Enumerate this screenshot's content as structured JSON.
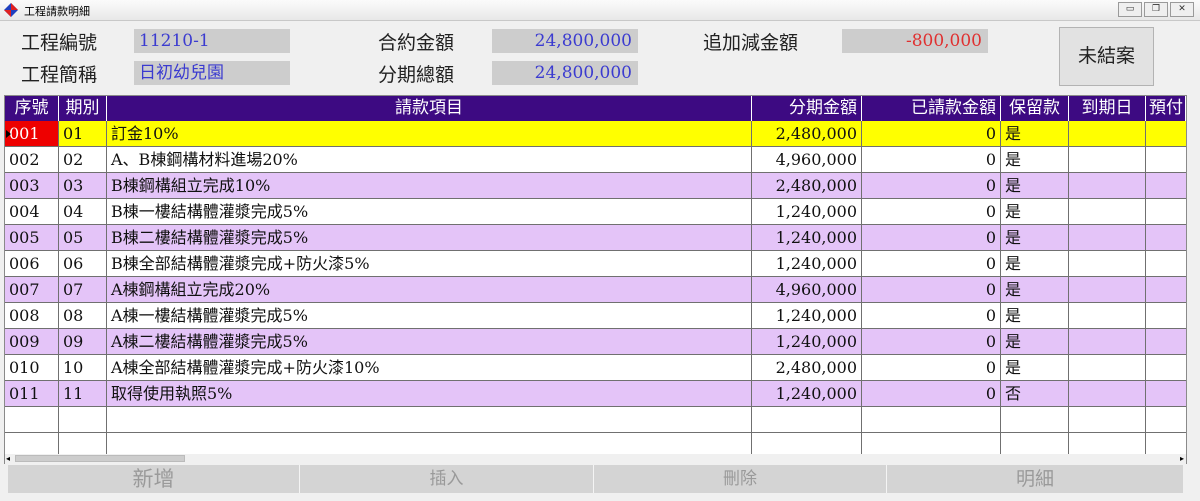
{
  "window": {
    "title": "工程請款明細",
    "min_glyph": "▭",
    "restore_glyph": "❐",
    "close_glyph": "✕"
  },
  "header": {
    "project_no_label": "工程編號",
    "project_no": "11210-1",
    "project_name_label": "工程簡稱",
    "project_name": "日初幼兒園",
    "contract_amount_label": "合約金額",
    "contract_amount": "24,800,000",
    "installment_total_label": "分期總額",
    "installment_total": "24,800,000",
    "adjust_amount_label": "追加減金額",
    "adjust_amount": "-800,000",
    "status_button": "未結案"
  },
  "table": {
    "columns": [
      "序號",
      "期別",
      "請款項目",
      "分期金額",
      "已請款金額",
      "保留款",
      "到期日",
      "預付"
    ],
    "rows": [
      {
        "seq": "001",
        "period": "01",
        "item": "訂金10%",
        "amount": "2,480,000",
        "requested": "0",
        "retention": "是",
        "due": ""
      },
      {
        "seq": "002",
        "period": "02",
        "item": "A、B棟鋼構材料進場20%",
        "amount": "4,960,000",
        "requested": "0",
        "retention": "是",
        "due": ""
      },
      {
        "seq": "003",
        "period": "03",
        "item": "B棟鋼構組立完成10%",
        "amount": "2,480,000",
        "requested": "0",
        "retention": "是",
        "due": ""
      },
      {
        "seq": "004",
        "period": "04",
        "item": "B棟一樓結構體灌漿完成5%",
        "amount": "1,240,000",
        "requested": "0",
        "retention": "是",
        "due": ""
      },
      {
        "seq": "005",
        "period": "05",
        "item": "B棟二樓結構體灌漿完成5%",
        "amount": "1,240,000",
        "requested": "0",
        "retention": "是",
        "due": ""
      },
      {
        "seq": "006",
        "period": "06",
        "item": "B棟全部結構體灌漿完成+防火漆5%",
        "amount": "1,240,000",
        "requested": "0",
        "retention": "是",
        "due": ""
      },
      {
        "seq": "007",
        "period": "07",
        "item": "A棟鋼構組立完成20%",
        "amount": "4,960,000",
        "requested": "0",
        "retention": "是",
        "due": ""
      },
      {
        "seq": "008",
        "period": "08",
        "item": "A棟一樓結構體灌漿完成5%",
        "amount": "1,240,000",
        "requested": "0",
        "retention": "是",
        "due": ""
      },
      {
        "seq": "009",
        "period": "09",
        "item": "A棟二樓結構體灌漿完成5%",
        "amount": "1,240,000",
        "requested": "0",
        "retention": "是",
        "due": ""
      },
      {
        "seq": "010",
        "period": "10",
        "item": "A棟全部結構體灌漿完成+防火漆10%",
        "amount": "2,480,000",
        "requested": "0",
        "retention": "是",
        "due": ""
      },
      {
        "seq": "011",
        "period": "11",
        "item": "取得使用執照5%",
        "amount": "1,240,000",
        "requested": "0",
        "retention": "否",
        "due": ""
      }
    ],
    "selected_row": 0
  },
  "toolbar": {
    "add": "新增",
    "insert": "插入",
    "delete": "刪除",
    "detail": "明細"
  },
  "colors": {
    "header_bg": "#3d0a82",
    "selected_row": "#ffff00",
    "alt_row": "#e4c4f8",
    "seq_highlight": "#ee0000",
    "field_text": "#3b3bd0",
    "negative": "#e03030"
  }
}
